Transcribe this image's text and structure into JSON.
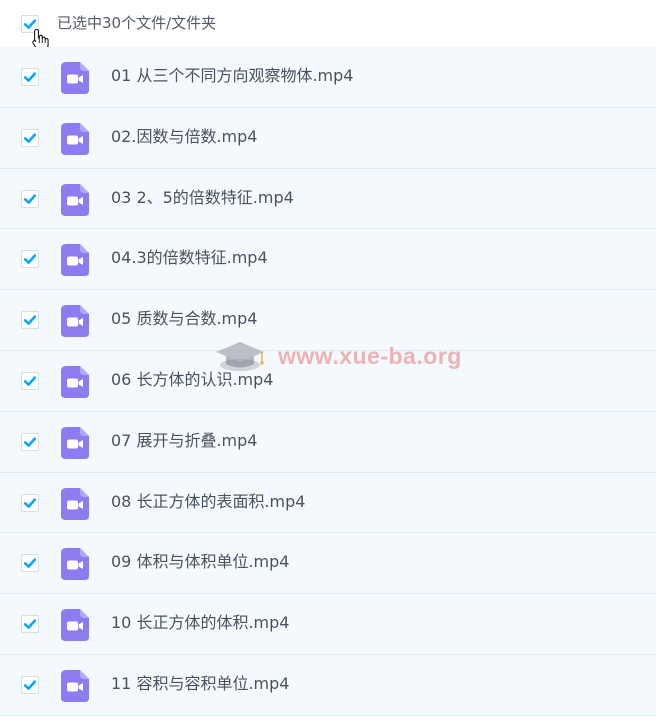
{
  "header": {
    "checked": true,
    "selection_label": "已选中30个文件/文件夹"
  },
  "colors": {
    "checkbox_tick": "#06a7ff",
    "file_icon": "#8c7cf0",
    "row_background": "#f4f9fd",
    "row_divider": "#dcebf6",
    "watermark": "#e87878"
  },
  "icons": {
    "checkbox": "checkmark-icon",
    "file": "video-file-icon",
    "cursor": "hand-pointer-icon",
    "watermark": "graduation-cap-icon"
  },
  "files": [
    {
      "name": "01 从三个不同方向观察物体.mp4",
      "checked": true
    },
    {
      "name": "02.因数与倍数.mp4",
      "checked": true
    },
    {
      "name": "03 2、5的倍数特征.mp4",
      "checked": true
    },
    {
      "name": "04.3的倍数特征.mp4",
      "checked": true
    },
    {
      "name": "05 质数与合数.mp4",
      "checked": true
    },
    {
      "name": "06 长方体的认识.mp4",
      "checked": true
    },
    {
      "name": "07 展开与折叠.mp4",
      "checked": true
    },
    {
      "name": "08 长正方体的表面积.mp4",
      "checked": true
    },
    {
      "name": "09 体积与体积单位.mp4",
      "checked": true
    },
    {
      "name": "10 长正方体的体积.mp4",
      "checked": true
    },
    {
      "name": "11 容积与容积单位.mp4",
      "checked": true
    }
  ],
  "watermark": {
    "text": "www.xue-ba.org"
  }
}
